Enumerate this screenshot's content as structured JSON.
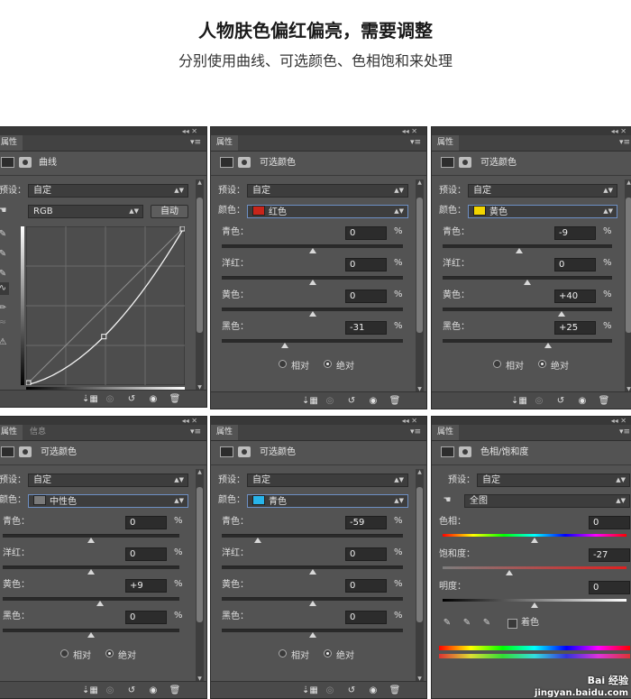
{
  "header": {
    "title": "人物肤色偏红偏亮，需要调整",
    "subtitle": "分别使用曲线、可选颜色、色相饱和来处理"
  },
  "common": {
    "tab_properties": "属性",
    "tab_info": "信息",
    "preset_label": "预设：",
    "preset_value": "自定",
    "colors_label": "颜色：",
    "relative_label": "相对",
    "absolute_label": "绝对",
    "percent": "%"
  },
  "curves_panel": {
    "title": "曲线",
    "channel": "RGB",
    "auto_button": "自动",
    "curve_points": [
      [
        0,
        0
      ],
      [
        125,
        78
      ],
      [
        255,
        255
      ]
    ]
  },
  "selective_panels": [
    {
      "title": "可选颜色",
      "color_value": "红色",
      "swatch_color": "#c8251b",
      "rows": [
        {
          "label": "青色：",
          "value": "0"
        },
        {
          "label": "洋红：",
          "value": "0"
        },
        {
          "label": "黄色：",
          "value": "0"
        },
        {
          "label": "黑色：",
          "value": "-31"
        }
      ]
    },
    {
      "title": "可选颜色",
      "color_value": "黄色",
      "swatch_color": "#f2d500",
      "rows": [
        {
          "label": "青色：",
          "value": "-9"
        },
        {
          "label": "洋红：",
          "value": "0"
        },
        {
          "label": "黄色：",
          "value": "+40"
        },
        {
          "label": "黑色：",
          "value": "+25"
        }
      ]
    },
    {
      "title": "可选颜色",
      "color_value": "中性色",
      "swatch_color": "#7a7a7a",
      "rows": [
        {
          "label": "青色：",
          "value": "0"
        },
        {
          "label": "洋红：",
          "value": "0"
        },
        {
          "label": "黄色：",
          "value": "+9"
        },
        {
          "label": "黑色：",
          "value": "0"
        }
      ]
    },
    {
      "title": "可选颜色",
      "color_value": "青色",
      "swatch_color": "#27b4ea",
      "rows": [
        {
          "label": "青色：",
          "value": "-59"
        },
        {
          "label": "洋红：",
          "value": "0"
        },
        {
          "label": "黄色：",
          "value": "0"
        },
        {
          "label": "黑色：",
          "value": "0"
        }
      ]
    }
  ],
  "hue_panel": {
    "title": "色相/饱和度",
    "range_value": "全图",
    "hue_label": "色相：",
    "hue_value": "0",
    "sat_label": "饱和度：",
    "sat_value": "-27",
    "light_label": "明度：",
    "light_value": "0",
    "colorize_label": "着色"
  },
  "watermark": {
    "brand": "Bai 经验",
    "url": "jingyan.baidu.com"
  }
}
